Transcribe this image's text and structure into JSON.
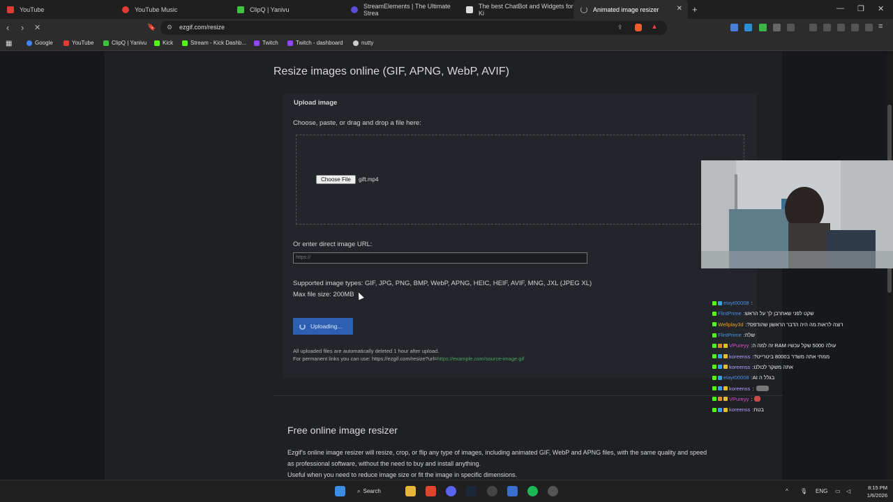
{
  "browser": {
    "tabs": [
      {
        "label": "YouTube",
        "color": "#e53935"
      },
      {
        "label": "YouTube Music",
        "color": "#e53935"
      },
      {
        "label": "ClipQ | Yanivu",
        "color": "#3ec43e"
      },
      {
        "label": "StreamElements | The Ultimate Strea",
        "color": "#5b4bd6"
      },
      {
        "label": "The best ChatBot and Widgets for Ki",
        "color": "#dddddd"
      },
      {
        "label": "Animated image resizer",
        "color": "#888888"
      }
    ],
    "url": "ezgif.com/resize",
    "bookmarks": [
      {
        "label": "Google",
        "color": "#4285f4"
      },
      {
        "label": "YouTube",
        "color": "#e53935"
      },
      {
        "label": "ClipQ | Yanivu",
        "color": "#3ec43e"
      },
      {
        "label": "Kick",
        "color": "#53fc18"
      },
      {
        "label": "Stream - Kick Dashb...",
        "color": "#53fc18"
      },
      {
        "label": "Twitch",
        "color": "#9146ff"
      },
      {
        "label": "Twitch - dashboard",
        "color": "#9146ff"
      },
      {
        "label": "nutty",
        "color": "#cccccc"
      }
    ]
  },
  "page": {
    "title": "Resize images online (GIF, APNG, WebP, AVIF)",
    "upload_heading": "Upload image",
    "choose_label": "Choose, paste, or drag and drop a file here:",
    "choose_button": "Choose File",
    "file_name": "gift.mp4",
    "url_label": "Or enter direct image URL:",
    "url_placeholder": "https://",
    "supported_types": "Supported image types: GIF, JPG, PNG, BMP, WebP, APNG, HEIC, HEIF, AVIF, MNG, JXL (JPEG XL)",
    "max_size": "Max file size: 200MB",
    "upload_button": "Uploading...",
    "auto_delete": "All uploaded files are automatically deleted 1 hour after upload.",
    "permalink_prefix": "For permanent links you can use: https://ezgif.com/resize?url=",
    "permalink_example": "https://example.com/source-image.gif",
    "section_title": "Free online image resizer",
    "paragraph1": "Ezgif's online image resizer will resize, crop, or flip any type of images, including animated GIF, WebP and APNG files, with the same quality and speed",
    "paragraph2": "as professional software, without the need to buy and install anything.",
    "paragraph3": "Useful when you need to reduce image size or fit the image in specific dimensions."
  },
  "chat": [
    {
      "user": "elayt00008",
      "user_color": "#4a90e2",
      "message": ""
    },
    {
      "user": "FlintPrime",
      "user_color": "#4a90e2",
      "message": "שקט לפני שאחרבן לך על הראש"
    },
    {
      "user": "Wellplay3d",
      "user_color": "#e0a030",
      "message": "רוצה לראות מה היה הדבר הראשון שהודפס?"
    },
    {
      "user": "FlintPrime",
      "user_color": "#4a90e2",
      "message": "שלח"
    },
    {
      "user": "VPureyy",
      "user_color": "#d94bd1",
      "message": "עולה 5000 שקל עכשיו RAM זה למה ה"
    },
    {
      "user": "koreenss",
      "user_color": "#b49cff",
      "message": "ממתי אתה משדר ב8000 ביטרייט?"
    },
    {
      "user": "koreenss",
      "user_color": "#b49cff",
      "message": "אתה משקר לכולנו"
    },
    {
      "user": "elayt00008",
      "user_color": "#4a90e2",
      "message": "בגלל ה AI"
    },
    {
      "user": "koreenss",
      "user_color": "#b49cff",
      "message": ""
    },
    {
      "user": "VPureyy",
      "user_color": "#d94bd1",
      "message": ""
    },
    {
      "user": "koreenss",
      "user_color": "#b49cff",
      "message": "בטח"
    }
  ],
  "taskbar": {
    "search_label": "Search",
    "language": "ENG",
    "time": "8:15 PM",
    "date": "1/6/2026"
  }
}
